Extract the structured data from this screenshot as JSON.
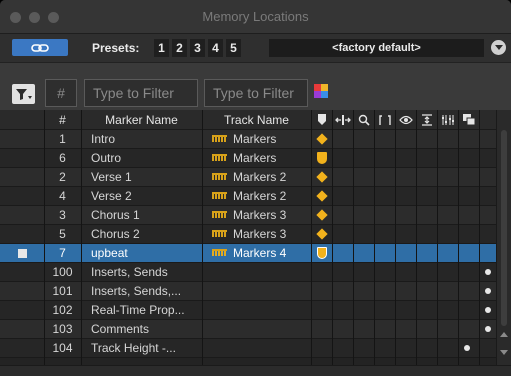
{
  "window": {
    "title": "Memory Locations"
  },
  "presets": {
    "label": "Presets:",
    "numbers": [
      "1",
      "2",
      "3",
      "4",
      "5"
    ],
    "selected": "<factory default>"
  },
  "filter": {
    "num_label": "#",
    "marker_placeholder": "Type to Filter",
    "track_placeholder": "Type to Filter"
  },
  "table": {
    "headers": {
      "num": "#",
      "marker_name": "Marker Name",
      "track_name": "Track Name"
    },
    "rows": [
      {
        "num": "1",
        "name": "Intro",
        "track": "Markers",
        "type": "diamond",
        "dot_col": null,
        "selected": false
      },
      {
        "num": "6",
        "name": "Outro",
        "track": "Markers",
        "type": "shield",
        "dot_col": null,
        "selected": false
      },
      {
        "num": "2",
        "name": "Verse 1",
        "track": "Markers 2",
        "type": "diamond",
        "dot_col": null,
        "selected": false
      },
      {
        "num": "4",
        "name": "Verse 2",
        "track": "Markers 2",
        "type": "diamond",
        "dot_col": null,
        "selected": false
      },
      {
        "num": "3",
        "name": "Chorus 1",
        "track": "Markers 3",
        "type": "diamond",
        "dot_col": null,
        "selected": false
      },
      {
        "num": "5",
        "name": "Chorus 2",
        "track": "Markers 3",
        "type": "diamond",
        "dot_col": null,
        "selected": false
      },
      {
        "num": "7",
        "name": "upbeat",
        "track": "Markers 4",
        "type": "shield",
        "dot_col": null,
        "selected": true
      },
      {
        "num": "100",
        "name": "Inserts, Sends",
        "track": "",
        "type": "",
        "dot_col": 8,
        "selected": false
      },
      {
        "num": "101",
        "name": "Inserts, Sends,...",
        "track": "",
        "type": "",
        "dot_col": 8,
        "selected": false
      },
      {
        "num": "102",
        "name": "Real-Time Prop...",
        "track": "",
        "type": "",
        "dot_col": 8,
        "selected": false
      },
      {
        "num": "103",
        "name": "Comments",
        "track": "",
        "type": "",
        "dot_col": 8,
        "selected": false
      },
      {
        "num": "104",
        "name": "Track Height -...",
        "track": "",
        "type": "",
        "dot_col": 7,
        "selected": false
      }
    ]
  },
  "colors": {
    "accent_blue": "#3b78c3",
    "selected_row": "#2f6ea6",
    "marker_yellow": "#f2b21c"
  },
  "icons": {
    "link": "link-icon",
    "filter_menu": "filter-menu-icon",
    "color_picker": "color-swatch-icon",
    "header_columns": [
      "marker-shield-icon",
      "zoom-settings-icon",
      "zoom-magnifier-icon",
      "pre-post-roll-icon",
      "track-show-hide-icon",
      "track-height-icon",
      "group-enables-icon",
      "window-config-icon"
    ]
  }
}
